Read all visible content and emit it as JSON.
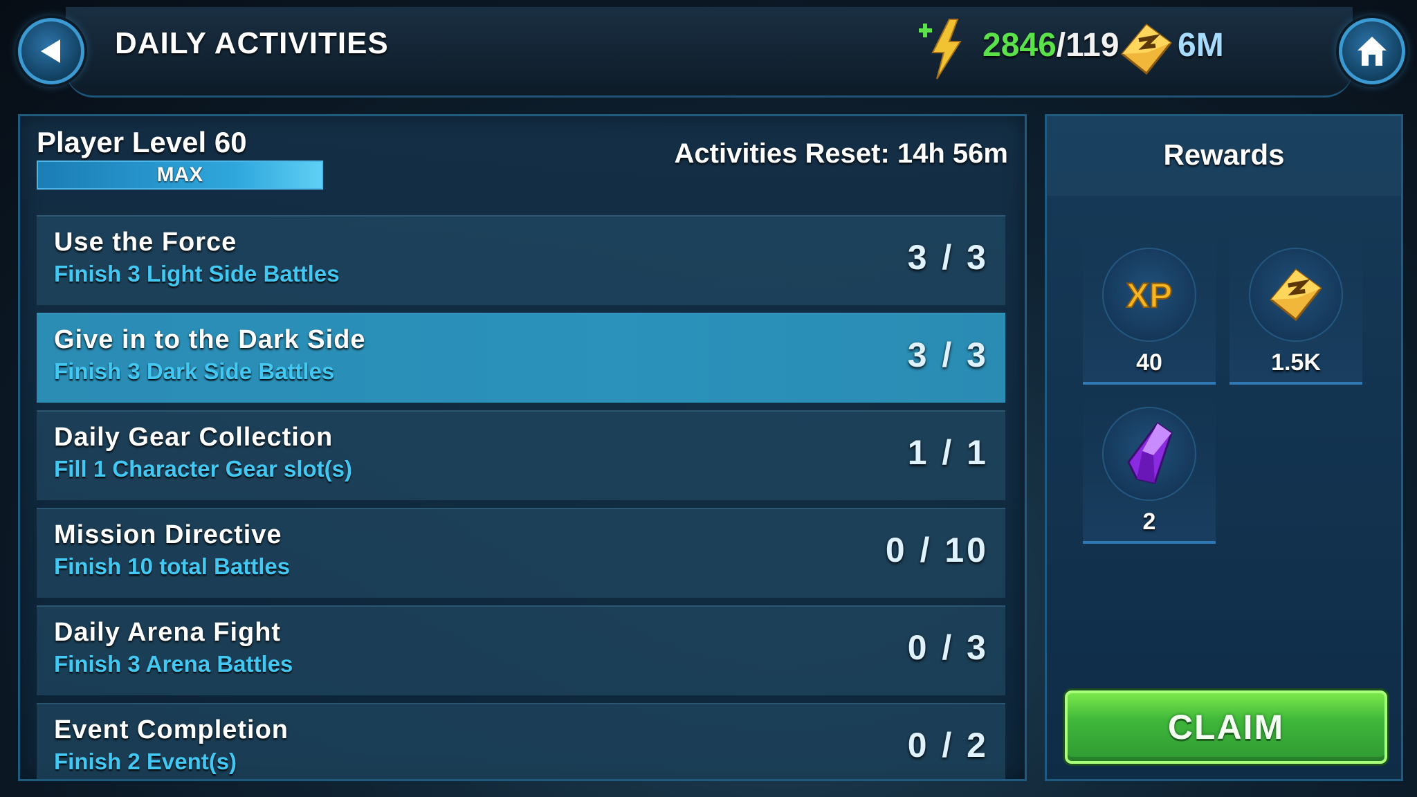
{
  "header": {
    "title": "DAILY ACTIVITIES",
    "energy_current": "2846",
    "energy_max": "/119",
    "credits": "6M"
  },
  "player": {
    "level_label": "Player Level 60",
    "progress_label": "MAX",
    "progress_fraction": 1.0
  },
  "reset_label": "Activities Reset: 14h 56m",
  "activities": [
    {
      "title": "Use the Force",
      "desc": "Finish 3 Light Side Battles",
      "progress": "3 / 3"
    },
    {
      "title": "Give in to the Dark Side",
      "desc": "Finish 3 Dark Side Battles",
      "progress": "3 / 3"
    },
    {
      "title": "Daily Gear Collection",
      "desc": "Fill 1 Character Gear slot(s)",
      "progress": "1 / 1"
    },
    {
      "title": "Mission Directive",
      "desc": "Finish 10 total Battles",
      "progress": "0 / 10"
    },
    {
      "title": "Daily Arena Fight",
      "desc": "Finish 3 Arena Battles",
      "progress": "0 / 3"
    },
    {
      "title": "Event Completion",
      "desc": "Finish 2 Event(s)",
      "progress": "0 / 2"
    }
  ],
  "rewards": {
    "title": "Rewards",
    "items": [
      {
        "icon": "xp-icon",
        "qty": "40"
      },
      {
        "icon": "credits-icon",
        "qty": "1.5K"
      },
      {
        "icon": "crystal-icon",
        "qty": "2"
      }
    ],
    "claim_label": "CLAIM"
  },
  "colors": {
    "accent_blue": "#42c8f2",
    "energy_green": "#5be24a",
    "claim_green": "#3fb73a",
    "highlight_row": "#2a92bb"
  }
}
